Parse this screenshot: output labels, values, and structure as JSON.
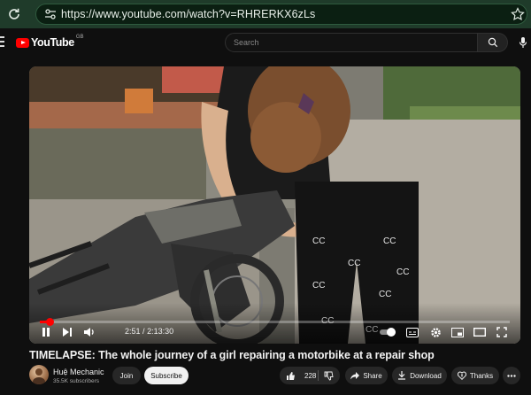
{
  "browser": {
    "url": "https://www.youtube.com/watch?v=RHRERKX6zLs"
  },
  "header": {
    "logo_text": "YouTube",
    "region": "GB",
    "search_placeholder": "Search"
  },
  "player": {
    "current_time": "2:51",
    "duration": "2:13:30",
    "time_separator": "/",
    "progress_fraction": 0.021
  },
  "video": {
    "title": "TIMELAPSE: The whole journey of a girl repairing a motorbike at a repair shop"
  },
  "channel": {
    "name": "Huệ Mechanic",
    "subscribers": "35.5K subscribers"
  },
  "actions": {
    "join": "Join",
    "subscribe": "Subscribe",
    "likes": "228",
    "share": "Share",
    "download": "Download",
    "thanks": "Thanks"
  },
  "colors": {
    "browser_bar": "#1f3b2a",
    "accent": "#ff0000",
    "background": "#0f0f0f"
  }
}
